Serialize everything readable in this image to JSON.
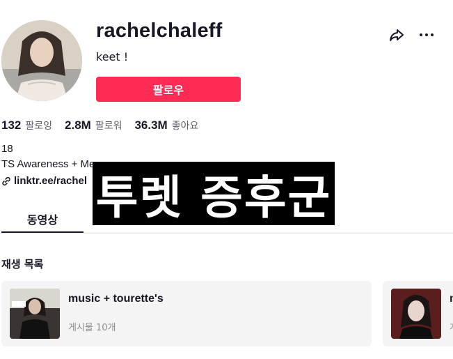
{
  "profile": {
    "username": "rachelchaleff",
    "nickname": "keet !",
    "follow_label": "팔로우"
  },
  "stats": [
    {
      "value": "132",
      "label": "팔로잉"
    },
    {
      "value": "2.8M",
      "label": "팔로워"
    },
    {
      "value": "36.3M",
      "label": "좋아요"
    }
  ],
  "bio": {
    "line1": "18",
    "line2": "TS Awareness + Me",
    "link": "linktr.ee/rachel"
  },
  "overlay_caption": "투렛 증후군",
  "tabs": [
    {
      "label": "동영상",
      "active": true
    }
  ],
  "section_title": "재생 목록",
  "playlists": [
    {
      "title": "music + tourette's",
      "count": "게시물 10개"
    },
    {
      "title": "m",
      "count": "게"
    }
  ],
  "icons": {
    "share": "share-icon",
    "more": "more-icon",
    "link": "link-icon"
  },
  "colors": {
    "accent": "#fe2c55",
    "text": "#161823",
    "muted": "#5f6068"
  }
}
